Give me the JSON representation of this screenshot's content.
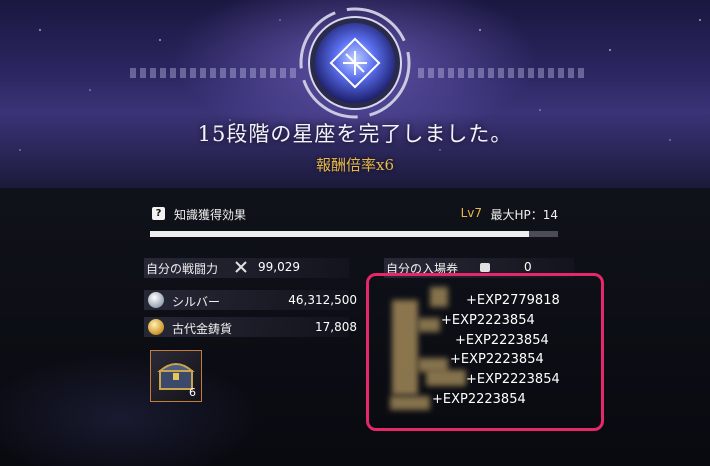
{
  "header": {
    "title": "15段階の星座を完了しました。",
    "multiplier": "報酬倍率x6"
  },
  "knowledge": {
    "label": "知識獲得効果",
    "level": "Lv7",
    "max_hp": "最大HP：14",
    "progress": 0.93
  },
  "stats": {
    "power_label": "自分の戦闘力",
    "power_value": "99,029",
    "tickets_label": "自分の入場券",
    "tickets_value": "0"
  },
  "resources": [
    {
      "icon": "silver-coin-icon",
      "label": "シルバー",
      "value": "46,312,500"
    },
    {
      "icon": "ancient-gold-coin-icon",
      "label": "古代金鋳貨",
      "value": "17,808"
    }
  ],
  "item": {
    "icon": "treasure-chest-icon",
    "count": "6"
  },
  "exp_log": [
    "+EXP2779818",
    "+EXP2223854",
    "+EXP2223854",
    "+EXP2223854",
    "+EXP2223854",
    "+EXP2223854"
  ],
  "colors": {
    "gold_text": "#e8b84a",
    "highlight_border": "#e6286a",
    "bar_fill": "#f0f0f0"
  }
}
